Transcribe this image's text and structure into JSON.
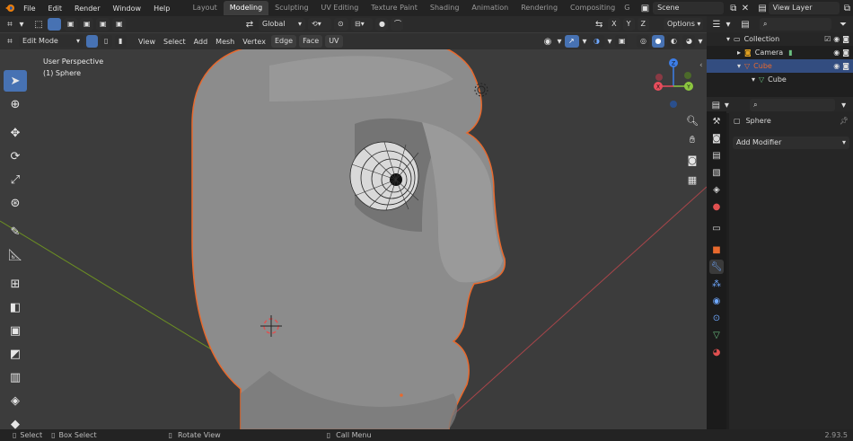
{
  "topbar": {
    "menus": [
      "File",
      "Edit",
      "Render",
      "Window",
      "Help"
    ],
    "workspaces": [
      "Layout",
      "Modeling",
      "Sculpting",
      "UV Editing",
      "Texture Paint",
      "Shading",
      "Animation",
      "Rendering",
      "Compositing",
      "G"
    ],
    "active_workspace": "Modeling",
    "scene": "Scene",
    "view_layer": "View Layer"
  },
  "viewport_header": {
    "orientation": "Global",
    "axes": [
      "X",
      "Y",
      "Z"
    ],
    "options": "Options"
  },
  "edit_header": {
    "mode": "Edit Mode",
    "menus": [
      "View",
      "Select",
      "Add",
      "Mesh",
      "Vertex",
      "Edge",
      "Face",
      "UV"
    ]
  },
  "viewport": {
    "perspective": "User Perspective",
    "object": "(1) Sphere"
  },
  "toolbar": {
    "tools": [
      "select-box",
      "cursor",
      "move",
      "rotate",
      "scale",
      "transform",
      "annotate",
      "measure",
      "add-cube",
      "extrude",
      "inset",
      "bevel",
      "loop-cut",
      "knife",
      "poly-build",
      "spin"
    ]
  },
  "outliner": {
    "collection": "Collection",
    "items": [
      "Camera",
      "Cube",
      "Cube"
    ]
  },
  "properties": {
    "object_name": "Sphere",
    "add_modifier": "Add Modifier"
  },
  "status": {
    "select": "Select",
    "box_select": "Box Select",
    "rotate_view": "Rotate View",
    "call_menu": "Call Menu",
    "version": "2.93.5"
  },
  "colors": {
    "accent": "#4772b3",
    "selection_outline": "#e8692d",
    "viewport_bg": "#3c3c3c"
  }
}
